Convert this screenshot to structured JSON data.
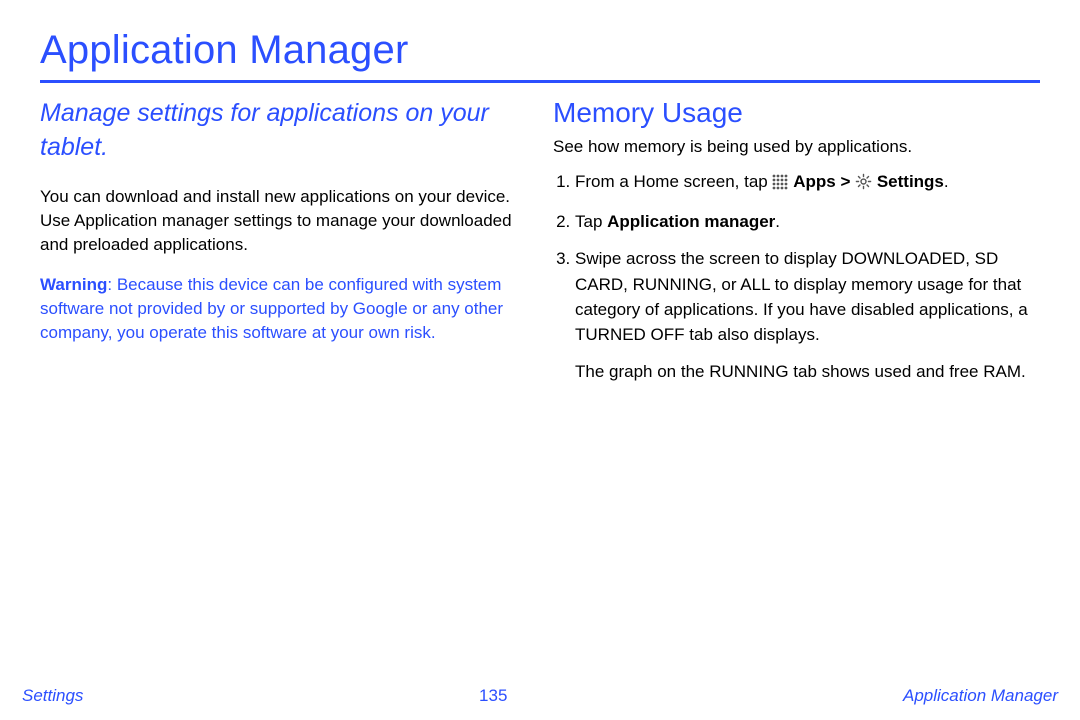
{
  "header": {
    "title": "Application Manager"
  },
  "left": {
    "subtitle": "Manage settings for applications on your tablet.",
    "intro": "You can download and install new applications on your device. Use Application manager settings to manage your downloaded and preloaded applications.",
    "warning_label": "Warning",
    "warning_body": ": Because this device can be configured with system software not provided by or supported by Google or any other company, you operate this software at your own risk."
  },
  "right": {
    "heading": "Memory Usage",
    "intro": "See how memory is being used by applications.",
    "step1_pre": "From a Home screen, tap ",
    "step1_apps": "Apps",
    "step1_gt": " > ",
    "step1_settings": "Settings",
    "step1_dot": ".",
    "step2_pre": "Tap ",
    "step2_bold": "Application manager",
    "step2_dot": ".",
    "step3": "Swipe across the screen to display DOWNLOADED, SD CARD, RUNNING, or ALL to display memory usage for that category of applications. If you have disabled applications, a TURNED OFF tab also displays.",
    "step3_note": "The graph on the RUNNING tab shows used and free RAM."
  },
  "footer": {
    "left": "Settings",
    "center": "135",
    "right": "Application Manager"
  }
}
